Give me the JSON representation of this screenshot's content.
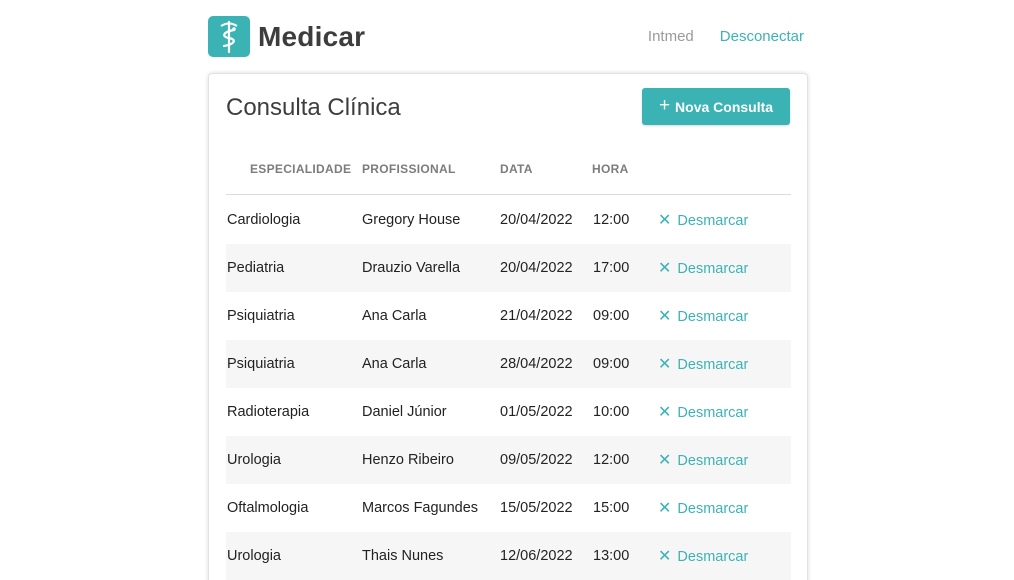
{
  "header": {
    "brand": "Medicar",
    "user": "Intmed",
    "logout_label": "Desconectar"
  },
  "main": {
    "title": "Consulta Clínica",
    "new_button_label": "Nova Consulta",
    "columns": [
      "ESPECIALIDADE",
      "PROFISSIONAL",
      "DATA",
      "HORA"
    ],
    "cancel_label": "Desmarcar",
    "rows": [
      {
        "especialidade": "Cardiologia",
        "profissional": "Gregory House",
        "data": "20/04/2022",
        "hora": "12:00"
      },
      {
        "especialidade": "Pediatria",
        "profissional": "Drauzio Varella",
        "data": "20/04/2022",
        "hora": "17:00"
      },
      {
        "especialidade": "Psiquiatria",
        "profissional": "Ana Carla",
        "data": "21/04/2022",
        "hora": "09:00"
      },
      {
        "especialidade": "Psiquiatria",
        "profissional": "Ana Carla",
        "data": "28/04/2022",
        "hora": "09:00"
      },
      {
        "especialidade": "Radioterapia",
        "profissional": "Daniel Júnior",
        "data": "01/05/2022",
        "hora": "10:00"
      },
      {
        "especialidade": "Urologia",
        "profissional": "Henzo Ribeiro",
        "data": "09/05/2022",
        "hora": "12:00"
      },
      {
        "especialidade": "Oftalmologia",
        "profissional": "Marcos Fagundes",
        "data": "15/05/2022",
        "hora": "15:00"
      },
      {
        "especialidade": "Urologia",
        "profissional": "Thais Nunes",
        "data": "12/06/2022",
        "hora": "13:00"
      }
    ]
  },
  "colors": {
    "accent": "#3bb3b5",
    "row_alt": "#f6f6f6"
  },
  "icons": {
    "logo": "caduceus-icon",
    "add": "plus-icon",
    "cancel": "close-icon"
  }
}
